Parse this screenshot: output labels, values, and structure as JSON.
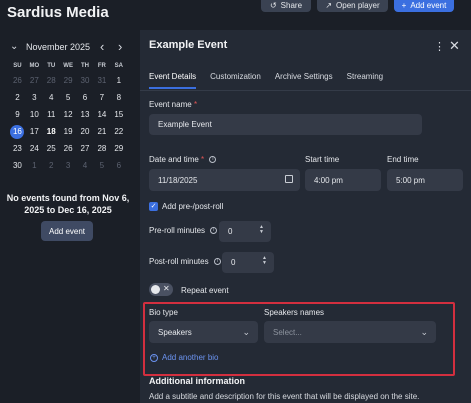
{
  "app": {
    "title": "Sardius Media"
  },
  "top_actions": {
    "share": "Share",
    "open_player": "Open player",
    "add_event": "Add event"
  },
  "calendar": {
    "month_label": "November 2025",
    "weekdays": [
      "SU",
      "MO",
      "TU",
      "WE",
      "TH",
      "FR",
      "SA"
    ],
    "days": [
      {
        "n": "26",
        "muted": true
      },
      {
        "n": "27",
        "muted": true
      },
      {
        "n": "28",
        "muted": true
      },
      {
        "n": "29",
        "muted": true
      },
      {
        "n": "30",
        "muted": true
      },
      {
        "n": "31",
        "muted": true
      },
      {
        "n": "1"
      },
      {
        "n": "2"
      },
      {
        "n": "3"
      },
      {
        "n": "4"
      },
      {
        "n": "5"
      },
      {
        "n": "6"
      },
      {
        "n": "7"
      },
      {
        "n": "8"
      },
      {
        "n": "9"
      },
      {
        "n": "10"
      },
      {
        "n": "11"
      },
      {
        "n": "12"
      },
      {
        "n": "13"
      },
      {
        "n": "14"
      },
      {
        "n": "15"
      },
      {
        "n": "16",
        "selected": true
      },
      {
        "n": "17"
      },
      {
        "n": "18",
        "bold": true
      },
      {
        "n": "19"
      },
      {
        "n": "20"
      },
      {
        "n": "21"
      },
      {
        "n": "22"
      },
      {
        "n": "23"
      },
      {
        "n": "24"
      },
      {
        "n": "25"
      },
      {
        "n": "26"
      },
      {
        "n": "27"
      },
      {
        "n": "28"
      },
      {
        "n": "29"
      },
      {
        "n": "30"
      },
      {
        "n": "1",
        "muted": true
      },
      {
        "n": "2",
        "muted": true
      },
      {
        "n": "3",
        "muted": true
      },
      {
        "n": "4",
        "muted": true
      },
      {
        "n": "5",
        "muted": true
      },
      {
        "n": "6",
        "muted": true
      }
    ],
    "empty_message": "No events found from Nov 6, 2025 to Dec 16, 2025",
    "add_button": "Add event"
  },
  "panel": {
    "title": "Example Event",
    "tabs": [
      "Event Details",
      "Customization",
      "Archive Settings",
      "Streaming"
    ],
    "active_tab": 0,
    "event_name": {
      "label": "Event name",
      "required": "*",
      "value": "Example Event"
    },
    "date_time": {
      "label": "Date and time",
      "required": "*",
      "value": "11/18/2025"
    },
    "start_time": {
      "label": "Start time",
      "value": "4:00 pm"
    },
    "end_time": {
      "label": "End time",
      "value": "5:00 pm"
    },
    "pre_post_roll": {
      "label": "Add pre-/post-roll",
      "checked": true
    },
    "pre_roll": {
      "label": "Pre-roll minutes",
      "value": "0"
    },
    "post_roll": {
      "label": "Post-roll minutes",
      "value": "0"
    },
    "repeat": {
      "label": "Repeat event",
      "on": false
    },
    "bio_type": {
      "label": "Bio type",
      "value": "Speakers"
    },
    "speakers_names": {
      "label": "Speakers names",
      "placeholder": "Select..."
    },
    "add_bio": "Add another bio",
    "additional": {
      "title": "Additional information",
      "description": "Add a subtitle and description for this event that will be displayed on the site."
    }
  },
  "colors": {
    "accent": "#3b6fe0",
    "highlight": "#d32f3f",
    "panel": "#242a35",
    "background": "#1b1f27"
  }
}
